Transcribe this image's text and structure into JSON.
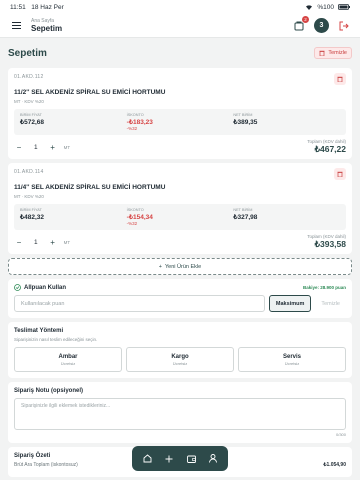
{
  "status": {
    "time": "11:51",
    "date": "18 Haz Per",
    "battery": "%100"
  },
  "header": {
    "subtitle": "Ana Sayfa",
    "title": "Sepetim",
    "cart_count": "2",
    "avatar_initial": "3"
  },
  "page": {
    "title": "Sepetim",
    "clear_label": "Temizle"
  },
  "products": [
    {
      "code": "01.AKD.112",
      "name": "11/2'' SEL AKDENİZ SPİRAL SU EMİCİ HORTUMU",
      "meta": "MT · KDV %20",
      "unit_price_label": "BİRİM FİYAT",
      "unit_price": "₺572,68",
      "discount_label": "İSKONTO",
      "discount": "-₺183,23",
      "discount_pct": "-%32",
      "net_label": "NET BİRİM",
      "net": "₺389,35",
      "qty": "1",
      "unit": "MT",
      "total_label": "Toplam (KDV dahil)",
      "total": "₺467,22"
    },
    {
      "code": "01.AKD.114",
      "name": "11/4'' SEL AKDENİZ SPİRAL SU EMİCİ HORTUMU",
      "meta": "MT · KDV %20",
      "unit_price_label": "BİRİM FİYAT",
      "unit_price": "₺482,32",
      "discount_label": "İSKONTO",
      "discount": "-₺154,34",
      "discount_pct": "-%32",
      "net_label": "NET BİRİM",
      "net": "₺327,98",
      "qty": "1",
      "unit": "MT",
      "total_label": "Toplam (KDV dahil)",
      "total": "₺393,58"
    }
  ],
  "add_product_label": "Yeni Ürün Ekle",
  "points": {
    "title": "Allpuan Kullan",
    "balance": "Bakiye: 28.900 puan",
    "placeholder": "Kullanılacak puan",
    "max_label": "Maksimum",
    "apply_label": "Temizle"
  },
  "delivery": {
    "title": "Teslimat Yöntemi",
    "subtitle": "Siparişinizin nasıl teslim edileceğini seçin.",
    "options": [
      {
        "name": "Ambar",
        "fee": "Ücretsiz"
      },
      {
        "name": "Kargo",
        "fee": "Ücretsiz"
      },
      {
        "name": "Servis",
        "fee": "Ücretsiz"
      }
    ]
  },
  "note": {
    "title": "Sipariş Notu (opsiyonel)",
    "placeholder": "Siparişinizle ilgili eklemek istedikleriniz...",
    "counter": "0/300"
  },
  "summary": {
    "title": "Sipariş Özeti",
    "row_label": "Brüt Ara Toplam (iskontosuz)",
    "row_value": "₺1.054,90"
  },
  "colors": {
    "primary": "#2d4a4a",
    "danger": "#d64545",
    "success": "#2e8b57"
  }
}
